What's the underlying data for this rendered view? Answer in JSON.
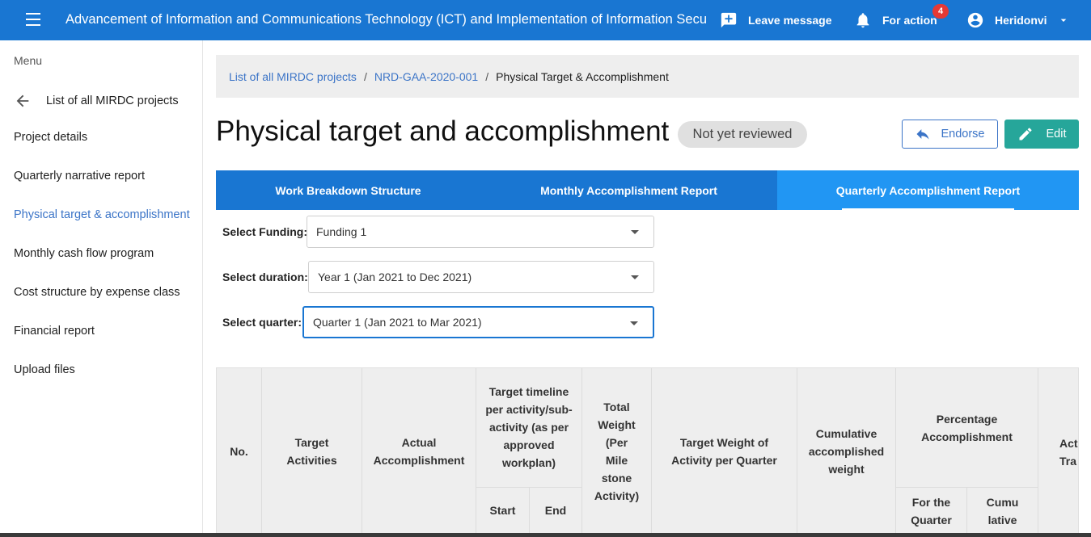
{
  "topbar": {
    "title": "Advancement of Information and Communications Technology (ICT) and Implementation of Information Secu",
    "leave_message": "Leave message",
    "for_action": "For action",
    "for_action_count": "4",
    "user": "Heridonvi",
    "color": "#1976d2"
  },
  "sidebar": {
    "menu_label": "Menu",
    "back_label": "List of all MIRDC projects",
    "items": [
      {
        "label": "Project details"
      },
      {
        "label": "Quarterly narrative report"
      },
      {
        "label": "Physical target & accomplishment"
      },
      {
        "label": "Monthly cash flow program"
      },
      {
        "label": "Cost structure by expense class"
      },
      {
        "label": "Financial report"
      },
      {
        "label": "Upload files"
      }
    ]
  },
  "breadcrumb": {
    "items": [
      "List of all MIRDC projects",
      "NRD-GAA-2020-001",
      "Physical Target & Accomplishment"
    ]
  },
  "page": {
    "title": "Physical target and accomplishment",
    "status": "Not yet reviewed",
    "endorse_label": "Endorse",
    "edit_label": "Edit"
  },
  "tabs": [
    {
      "label": "Work Breakdown Structure"
    },
    {
      "label": "Monthly Accomplishment Report"
    },
    {
      "label": "Quarterly Accomplishment Report"
    }
  ],
  "filters": {
    "funding": {
      "label": "Select Funding:",
      "value": "Funding 1"
    },
    "duration": {
      "label": "Select duration:",
      "value": "Year 1 (Jan 2021 to Dec 2021)"
    },
    "quarter": {
      "label": "Select quarter:",
      "value": "Quarter 1 (Jan 2021 to Mar 2021)"
    }
  },
  "table": {
    "headers": {
      "no": "No.",
      "target_activities": "Target Activities",
      "actual_accomplishment": "Actual Accomplishment",
      "timeline": "Target timeline per activity/sub-activity (as per approved workplan)",
      "start": "Start",
      "end": "End",
      "total_weight": "Total Weight (Per Mile stone Activity)",
      "target_weight": "Target Weight of Activity per Quarter",
      "cumulative_weight": "Cumulative accomplished weight",
      "percentage": "Percentage Accomplishment",
      "for_quarter": "For the Quarter",
      "cumulative": "Cumu lative",
      "action_truncated": "Acti Tra"
    }
  }
}
